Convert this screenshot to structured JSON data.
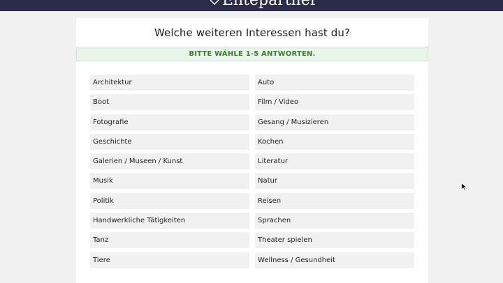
{
  "header": {
    "logo_text": "Elitepartner",
    "icon": "logo-heart-icon"
  },
  "question": {
    "title": "Welche weiteren Interessen hast du?",
    "hint": "BITTE WÄHLE 1-5 ANTWORTEN."
  },
  "options": [
    "Architektur",
    "Auto",
    "Boot",
    "Film / Video",
    "Fotografie",
    "Gesang / Musizieren",
    "Geschichte",
    "Kochen",
    "Galerien / Museen / Kunst",
    "Literatur",
    "Musik",
    "Natur",
    "Politik",
    "Reisen",
    "Handwerkliche Tätigkeiten",
    "Sprachen",
    "Tanz",
    "Theater spielen",
    "Tiere",
    "Wellness / Gesundheit"
  ],
  "colors": {
    "header_bg": "#2e2b4a",
    "hint_bg": "#e9f5ea",
    "hint_text": "#3f7d33",
    "option_bg": "#f1f1f1"
  }
}
